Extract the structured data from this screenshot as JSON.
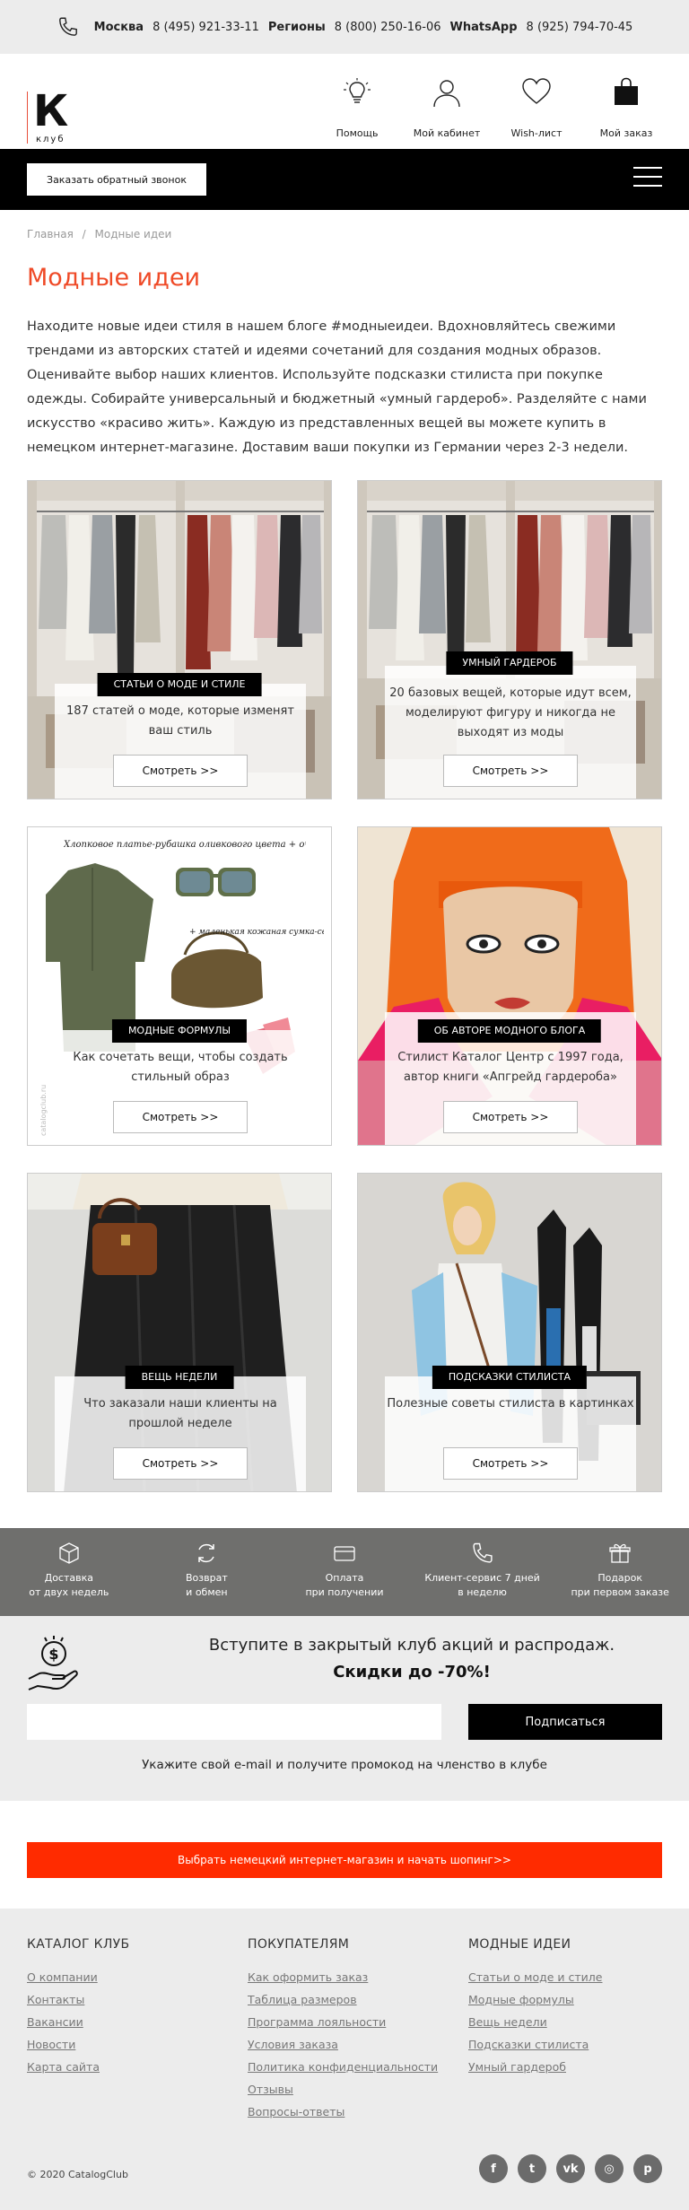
{
  "topbar": {
    "moscow_label": "Москва",
    "moscow_phone": "8 (495) 921-33-11",
    "regions_label": "Регионы",
    "regions_phone": "8 (800) 250-16-06",
    "whatsapp_label": "WhatsApp",
    "whatsapp_phone": "8 (925) 794-70-45"
  },
  "logo": {
    "letter": "К",
    "word": "клуб"
  },
  "header_nav": [
    {
      "label": "Помощь",
      "icon": "lightbulb-icon"
    },
    {
      "label": "Мой кабинет",
      "icon": "user-icon"
    },
    {
      "label": "Wish-лист",
      "icon": "heart-icon"
    },
    {
      "label": "Мой заказ",
      "icon": "bag-icon"
    }
  ],
  "callback_label": "Заказать обратный звонок",
  "breadcrumb": {
    "home": "Главная",
    "sep": "/",
    "current": "Модные идеи"
  },
  "page_title": "Модные идеи",
  "intro": "Находите новые идеи стиля в нашем блоге #модныеидеи. Вдохновляйтесь свежими трендами из авторских статей и идеями сочетаний для создания модных образов. Оценивайте выбор наших клиентов. Используйте подсказки стилиста при покупке одежды. Собирайте универсальный и бюджетный «умный гардероб». Разделяйте с нами искусство «красиво жить». Каждую из представленных вещей вы можете купить в немецком интернет-магазине. Доставим ваши покупки из Германии через 2-3 недели.",
  "cards": [
    {
      "label": "СТАТЬИ О МОДЕ И СТИЛЕ",
      "desc": "187 статей о моде, которые изменят ваш стиль",
      "button": "Смотреть >>"
    },
    {
      "label": "УМНЫЙ ГАРДЕРОБ",
      "desc": "20 базовых вещей, которые идут всем, моделируют фигуру и никогда не выходят из моды",
      "button": "Смотреть >>"
    },
    {
      "label": "МОДНЫЕ ФОРМУЛЫ",
      "desc": "Как сочетать вещи, чтобы создать стильный образ",
      "button": "Смотреть >>",
      "img_text1": "Хлопковое платье-рубашка оливкового цвета + очки с зеленой оправой",
      "img_text2": "+ маленькая кожаная сумка-седло",
      "watermark": "catalogclub.ru"
    },
    {
      "label": "ОБ АВТОРЕ МОДНОГО БЛОГА",
      "desc": "Стилист Каталог Центр с 1997 года, автор книги «Апгрейд гардероба»",
      "button": "Смотреть >>"
    },
    {
      "label": "ВЕЩЬ НЕДЕЛИ",
      "desc": "Что заказали наши клиенты на прошлой неделе",
      "button": "Смотреть >>"
    },
    {
      "label": "ПОДСКАЗКИ СТИЛИСТА",
      "desc": "Полезные советы стилиста в картинках",
      "button": "Смотреть >>"
    }
  ],
  "features": [
    {
      "line1": "Доставка",
      "line2": "от двух недель",
      "icon": "box-icon"
    },
    {
      "line1": "Возврат",
      "line2": "и обмен",
      "icon": "refresh-icon"
    },
    {
      "line1": "Оплата",
      "line2": "при получении",
      "icon": "card-icon"
    },
    {
      "line1": "Клиент-сервис 7 дней",
      "line2": "в неделю",
      "icon": "phone-icon"
    },
    {
      "line1": "Подарок",
      "line2": "при первом заказе",
      "icon": "gift-icon"
    }
  ],
  "subscribe": {
    "title": "Вступите в закрытый клуб акций и распродаж.",
    "discount": "Скидки до -70%!",
    "email_placeholder": "",
    "button": "Подписаться",
    "note": "Укажите свой e-mail и получите промокод на членство в клубе"
  },
  "cta": "Выбрать немецкий интернет-магазин и начать шопинг>>",
  "footer": {
    "columns": [
      {
        "title": "КАТАЛОГ КЛУБ",
        "links": [
          "О компании",
          "Контакты",
          "Вакансии",
          "Новости",
          "Карта сайта"
        ]
      },
      {
        "title": "ПОКУПАТЕЛЯМ",
        "links": [
          "Как оформить заказ",
          "Таблица размеров",
          "Программа лояльности",
          "Условия заказа",
          "Политика конфиденциальности",
          "Отзывы",
          "Вопросы-ответы"
        ]
      },
      {
        "title": "МОДНЫЕ ИДЕИ",
        "links": [
          "Статьи о моде и стиле",
          "Модные формулы",
          "Вещь недели",
          "Подсказки стилиста",
          "Умный гардероб"
        ]
      }
    ],
    "copyright": "© 2020 CatalogClub",
    "socials": [
      {
        "icon": "facebook-icon",
        "glyph": "f"
      },
      {
        "icon": "twitter-icon",
        "glyph": "t"
      },
      {
        "icon": "vk-icon",
        "glyph": "vk"
      },
      {
        "icon": "instagram-icon",
        "glyph": "◎"
      },
      {
        "icon": "pinterest-icon",
        "glyph": "p"
      }
    ]
  },
  "colors": {
    "accent": "#ef4a27",
    "cta": "#ff2b00",
    "features_bg": "#6f6f6d",
    "light_bg": "#ececec"
  }
}
